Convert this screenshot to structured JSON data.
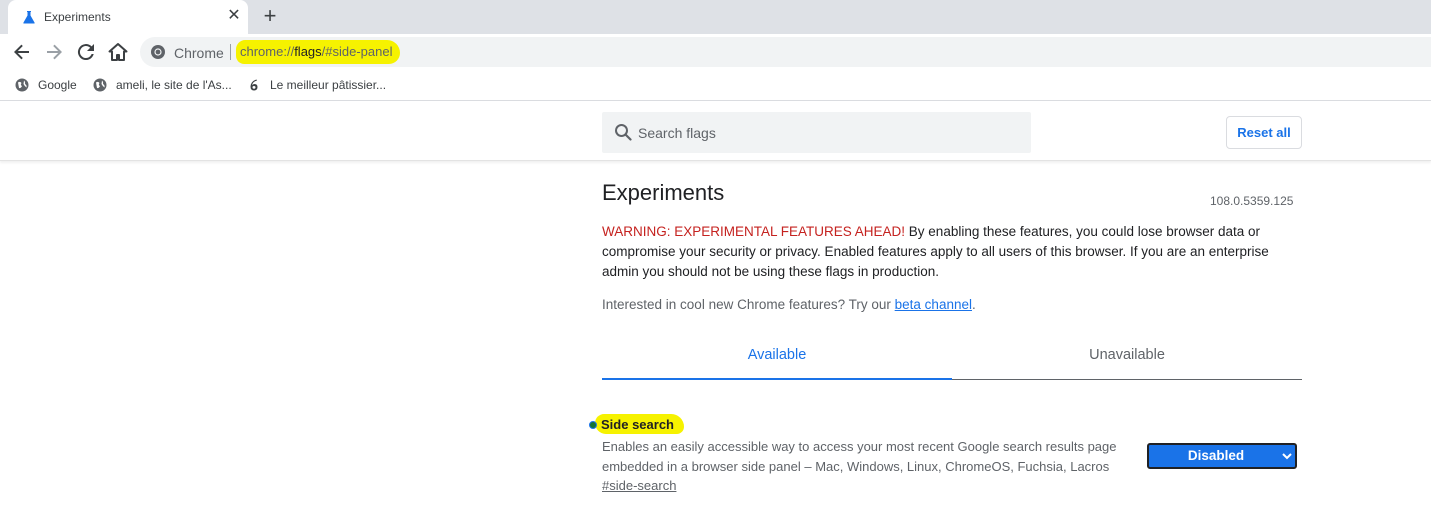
{
  "browser": {
    "tab_title": "Experiments",
    "tab_close_glyph": "✕",
    "new_tab_glyph": "+",
    "omnibox": {
      "site_label": "Chrome",
      "url_prefix": "chrome://",
      "url_host": "flags",
      "url_rest": "/#side-panel"
    },
    "bookmarks": [
      {
        "label": "Google",
        "icon": "globe-icon"
      },
      {
        "label": "ameli, le site de l'As...",
        "icon": "globe-icon"
      },
      {
        "label": "Le meilleur pâtissier...",
        "icon": "six-logo-icon"
      }
    ]
  },
  "header": {
    "search_placeholder": "Search flags",
    "reset_label": "Reset all"
  },
  "main": {
    "title": "Experiments",
    "version": "108.0.5359.125",
    "warning_label": "WARNING: EXPERIMENTAL FEATURES AHEAD!",
    "warning_text": " By enabling these features, you could lose browser data or compromise your security or privacy. Enabled features apply to all users of this browser. If you are an enterprise admin you should not be using these flags in production.",
    "interested_text": "Interested in cool new Chrome features? Try our ",
    "interested_link": "beta channel",
    "interested_end": ".",
    "tabs": [
      {
        "label": "Available",
        "active": true
      },
      {
        "label": "Unavailable",
        "active": false
      }
    ],
    "flag": {
      "name": "Side search",
      "description": "Enables an easily accessible way to access your most recent Google search results page embedded in a browser side panel – Mac, Windows, Linux, ChromeOS, Fuchsia, Lacros",
      "link": "#side-search",
      "selected": "Disabled"
    }
  },
  "colors": {
    "accent": "#1a73e8",
    "warning": "#c5221f",
    "highlight": "#f6f200",
    "tabstrip": "#dee1e6"
  }
}
